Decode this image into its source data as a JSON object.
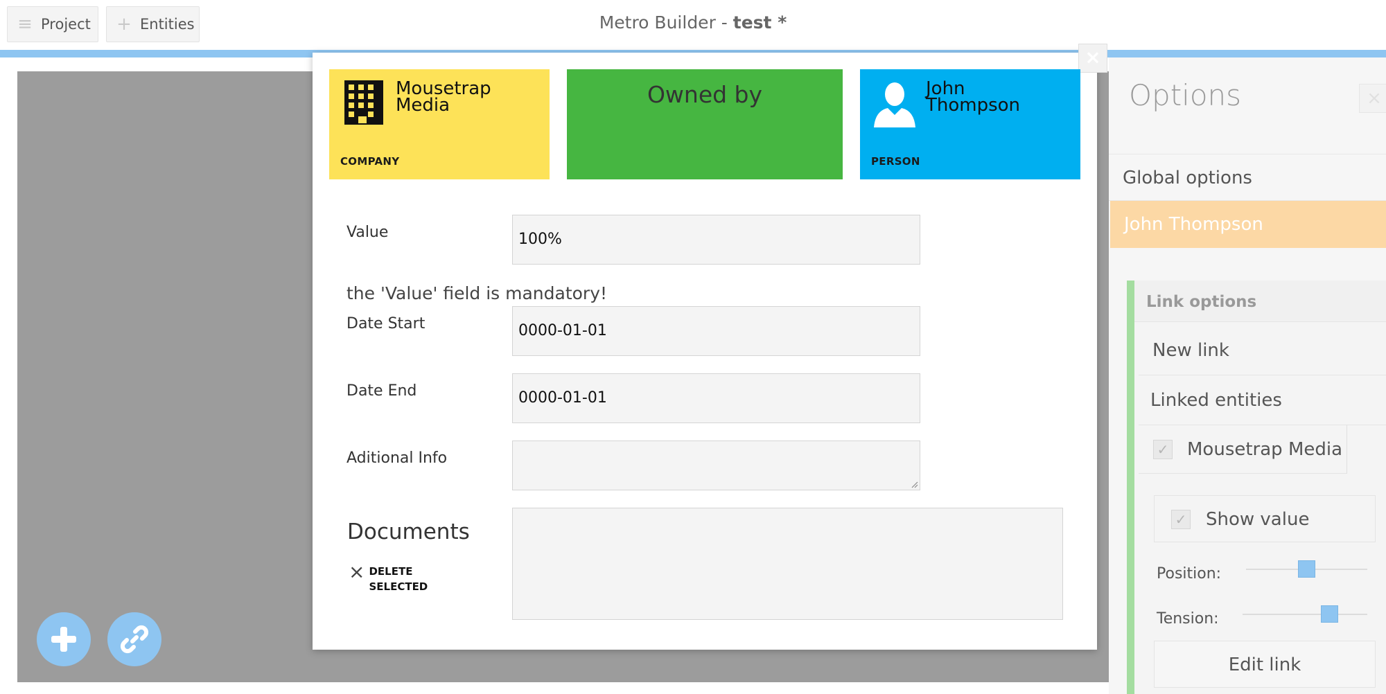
{
  "topbar": {
    "project_label": "Project",
    "entities_label": "Entities",
    "app_name": "Metro Builder - ",
    "project_name": "test *"
  },
  "modal": {
    "close_glyph": "×",
    "tiles": {
      "company_name": "Mousetrap Media",
      "company_type": "COMPANY",
      "relation": "Owned by",
      "person_name": "John Thompson",
      "person_type": "PERSON"
    },
    "fields": {
      "value_label": "Value",
      "value": "100%",
      "mandatory_msg": "the 'Value' field is mandatory!",
      "date_start_label": "Date Start",
      "date_start": "0000-01-01",
      "date_end_label": "Date End",
      "date_end": "0000-01-01",
      "info_label": "Aditional Info",
      "info_value": ""
    },
    "documents": {
      "title": "Documents",
      "delete_line1": "DELETE",
      "delete_line2": "SELECTED"
    }
  },
  "options": {
    "title": "Options",
    "close_glyph": "×",
    "global_label": "Global options",
    "selected_entity": "John Thompson",
    "link_options_label": "Link options",
    "new_link_label": "New link",
    "linked_entities_label": "Linked entities",
    "linked_entity_name": "Mousetrap Media",
    "linked_entity_checked": true,
    "show_value_label": "Show value",
    "show_value_checked": true,
    "position_label": "Position:",
    "position_level": 0.5,
    "tension_label": "Tension:",
    "tension_level": 0.7,
    "edit_link_label": "Edit link"
  },
  "icons": {
    "menu": "menu-icon",
    "plus": "plus-icon",
    "building": "building-icon",
    "person": "person-icon",
    "link": "link-icon",
    "check": "check-icon",
    "delete": "x-icon"
  },
  "colors": {
    "accent_blue": "#8ec5f1",
    "company_yellow": "#fde258",
    "relation_green": "#46b641",
    "person_blue": "#00aff0",
    "selected_orange": "#fcd8a5",
    "link_green": "#a4dda0",
    "canvas_gray": "#9c9c9c"
  }
}
